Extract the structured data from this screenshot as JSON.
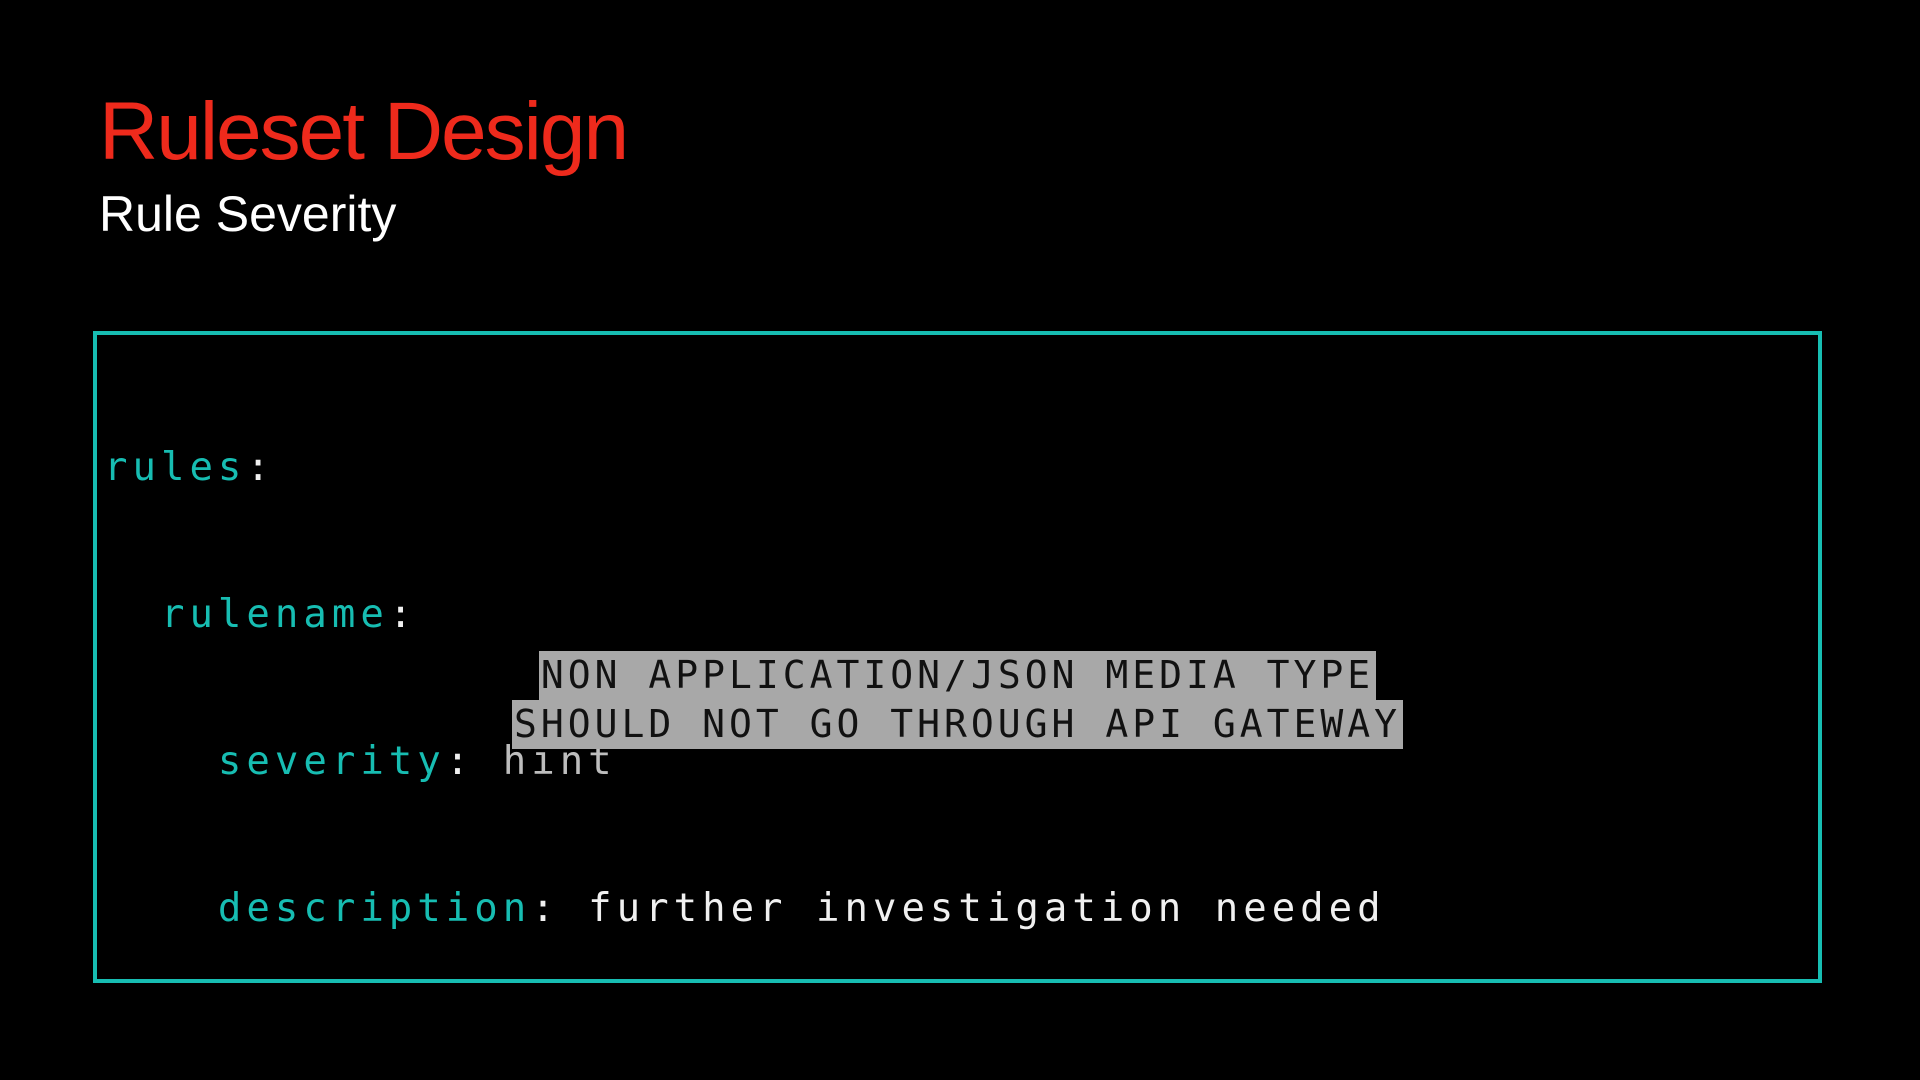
{
  "colors": {
    "background": "#000000",
    "title": "#ee2a1c",
    "subtitle": "#ffffff",
    "frame_border": "#17bdb2",
    "code_key": "#17bdb2",
    "code_value_hint": "#bdbdbd",
    "code_value_text": "#f0f0f0",
    "note_background": "#a8a8a8",
    "note_text": "#111111"
  },
  "slide": {
    "title": "Ruleset Design",
    "subtitle": "Rule Severity"
  },
  "code": {
    "rules_key": "rules",
    "rulename_key": "rulename",
    "severity_key": "severity",
    "severity_value": "hint",
    "description_key": "description",
    "description_value": "further investigation needed",
    "separator": ":"
  },
  "note": {
    "line1": "NON APPLICATION/JSON MEDIA TYPE",
    "line2": "SHOULD NOT GO THROUGH API GATEWAY"
  }
}
